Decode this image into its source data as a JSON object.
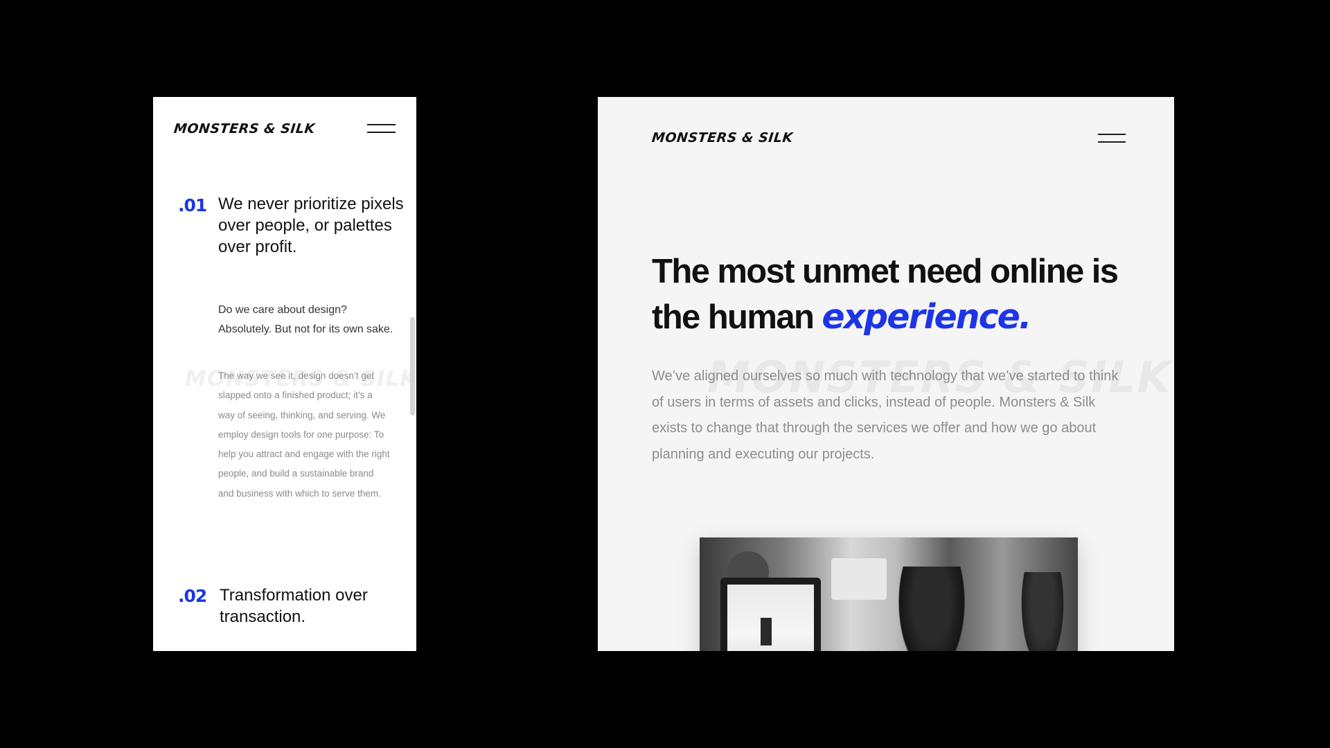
{
  "mobile": {
    "logo": "MONSTERS & SILK",
    "menu_icon": "hamburger-icon",
    "watermark": "MONSTERS & SILK",
    "sections": [
      {
        "number": ".01",
        "heading": "We never prioritize pixels over people, or palettes over profit.",
        "lead": "Do we care about design? Absolutely. But not for its own sake.",
        "body": "The way we see it, design doesn’t get slapped onto a finished product; it’s a way of seeing, thinking, and serving. We employ design tools for one purpose: To help you attract and engage with the right people, and build a sustainable brand and business with which to serve them."
      },
      {
        "number": ".02",
        "heading": "Transformation over transaction."
      }
    ]
  },
  "desktop": {
    "logo": "MONSTERS & SILK",
    "menu_icon": "hamburger-icon",
    "watermark": "MONSTERS & SILK",
    "headline_main": "The most unmet need online is the human ",
    "headline_accent": "experience.",
    "paragraph": "We’ve aligned ourselves so much with technology that we’ve started to think of users in terms of assets and clicks, instead of people. Monsters & Silk exists to change that through the services we offer and how we go about planning and executing our projects.",
    "photo_alt": "team-photo"
  },
  "colors": {
    "background": "#000000",
    "mobile_bg": "#ffffff",
    "desktop_bg": "#f5f5f5",
    "accent": "#1d35e6",
    "heading": "#111111",
    "muted": "#8c8c8c"
  }
}
